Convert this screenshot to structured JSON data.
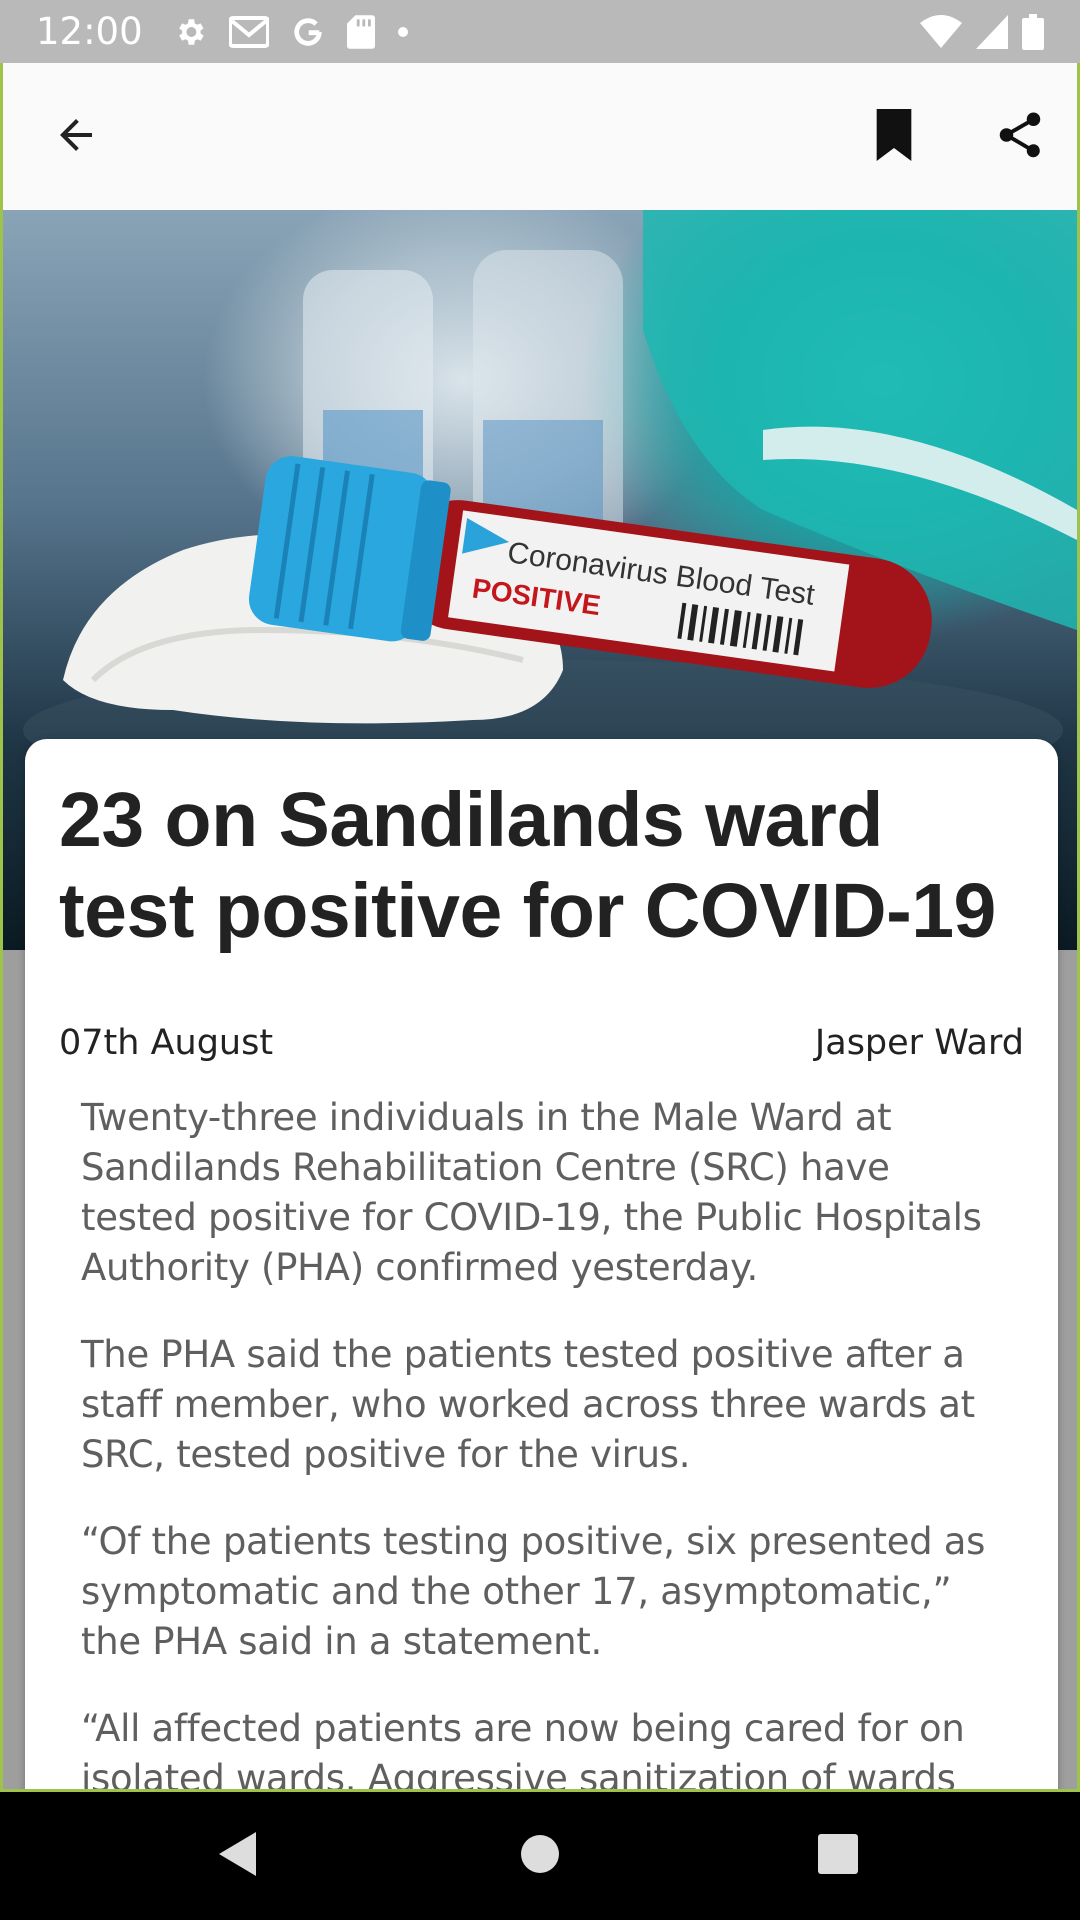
{
  "status_bar": {
    "time": "12:00",
    "icons_left": [
      "settings-icon",
      "gmail-icon",
      "google-icon",
      "sd-card-icon",
      "dot-icon"
    ],
    "icons_right": [
      "wifi-icon",
      "signal-icon",
      "battery-icon"
    ]
  },
  "app_bar": {
    "back_icon": "arrow-back-icon",
    "bookmark_icon": "bookmark-icon",
    "share_icon": "share-icon"
  },
  "hero_image": {
    "label_line1": "Coronavirus Blood Test",
    "label_line2": "POSITIVE"
  },
  "article": {
    "headline": "23 on Sandilands ward test positive for COVID-19",
    "date": "07th August",
    "author": "Jasper Ward",
    "paragraphs": [
      "Twenty-three individuals in the Male Ward at Sandilands Rehabilitation Centre (SRC) have tested positive for COVID-19, the Public Hospitals Authority (PHA) confirmed yesterday.",
      "The PHA said the patients tested positive after a staff member, who worked across three wards at SRC, tested positive for the virus.",
      "“Of the patients testing positive, six presented as symptomatic and the other 17, asymptomatic,” the PHA said in a statement.",
      "“All affected patients are now being cared for on isolated wards. Aggressive sanitization of wards"
    ]
  },
  "nav_bar": {
    "back_icon": "triangle-back-icon",
    "home_icon": "circle-home-icon",
    "recents_icon": "square-recents-icon"
  },
  "colors": {
    "status_bar": "#b9b9b9",
    "frame_outline": "#9dc34a",
    "headline": "#222222",
    "body_text": "#5f5f5f"
  }
}
